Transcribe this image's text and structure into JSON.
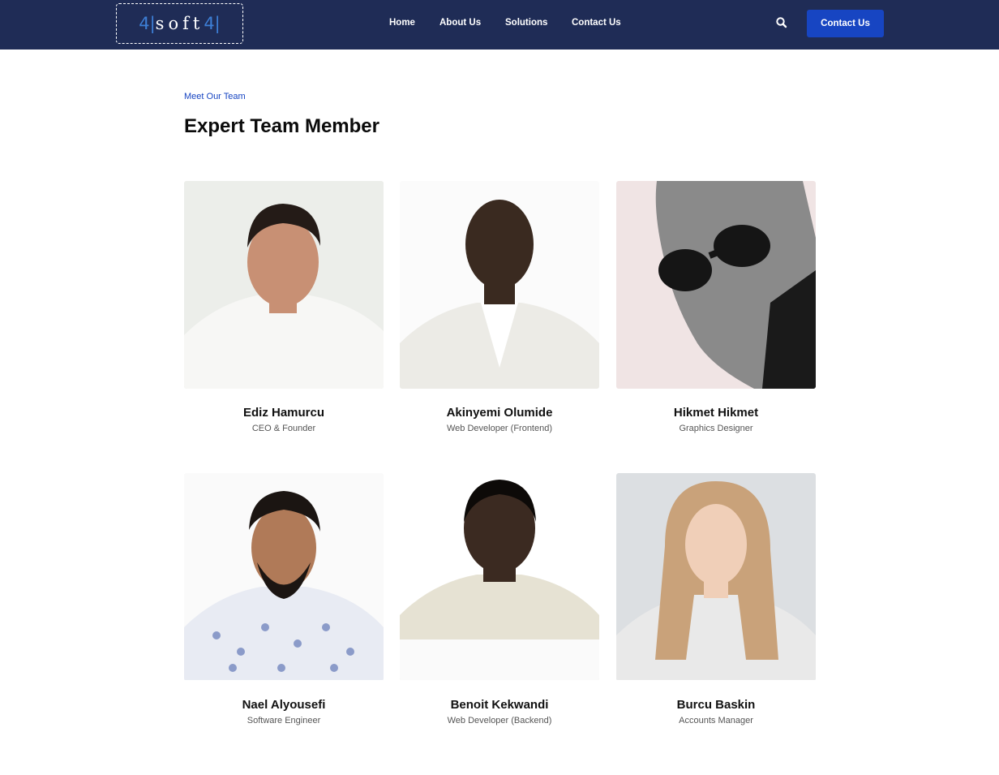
{
  "header": {
    "logo_text": "soft",
    "logo_mark": "4|",
    "nav": [
      "Home",
      "About Us",
      "Solutions",
      "Contact Us"
    ],
    "search_icon": "search-icon",
    "cta_label": "Contact Us",
    "colors": {
      "bar": "#1f2c56",
      "accent": "#1745c2"
    }
  },
  "section": {
    "eyebrow": "Meet Our Team",
    "title": "Expert Team Member"
  },
  "team": [
    {
      "name": "Ediz Hamurcu",
      "role": "CEO & Founder"
    },
    {
      "name": "Akinyemi Olumide",
      "role": "Web Developer (Frontend)"
    },
    {
      "name": "Hikmet Hikmet",
      "role": "Graphics Designer"
    },
    {
      "name": "Nael Alyousefi",
      "role": "Software Engineer"
    },
    {
      "name": "Benoit Kekwandi",
      "role": "Web Developer (Backend)"
    },
    {
      "name": "Burcu Baskin",
      "role": "Accounts Manager"
    }
  ]
}
